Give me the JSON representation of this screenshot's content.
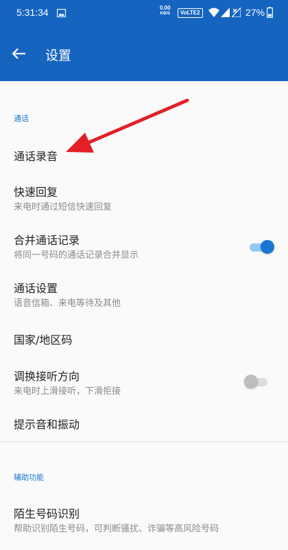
{
  "status_bar": {
    "time": "5:31:34",
    "net_rate_value": "0.00",
    "net_rate_unit": "KB/S",
    "volte_badge": "VoLTE2",
    "battery_percent": "27%"
  },
  "toolbar": {
    "title": "设置"
  },
  "sections": [
    {
      "label": "通话"
    },
    {
      "label": "辅助功能"
    }
  ],
  "rows": [
    {
      "title": "通话录音"
    },
    {
      "title": "快速回复",
      "subtitle": "来电时通过短信快速回复"
    },
    {
      "title": "合并通话记录",
      "subtitle": "将同一号码的通话记录合并显示",
      "toggle_on": true
    },
    {
      "title": "通话设置",
      "subtitle": "语音信箱、来电等待及其他"
    },
    {
      "title": "国家/地区码"
    },
    {
      "title": "调换接听方向",
      "subtitle": "来电时上滑接听，下滑拒接",
      "toggle_on": false
    },
    {
      "title": "提示音和振动"
    },
    {
      "title": "陌生号码识别",
      "subtitle": "帮助识别陌生号码，可判断骚扰、诈骗等高风险号码"
    }
  ],
  "colors": {
    "header": "#1565c0",
    "accent": "#1976d2",
    "annotation_arrow": "#e32028"
  }
}
